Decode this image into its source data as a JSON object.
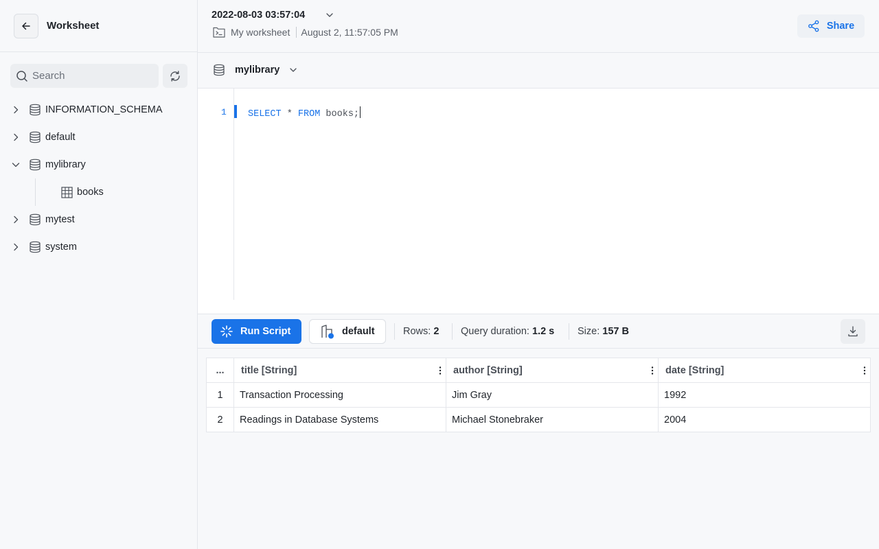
{
  "sidebar": {
    "title": "Worksheet",
    "search_placeholder": "Search",
    "databases": [
      {
        "label": "INFORMATION_SCHEMA",
        "expanded": false
      },
      {
        "label": "default",
        "expanded": false
      },
      {
        "label": "mylibrary",
        "expanded": true,
        "tables": [
          "books"
        ]
      },
      {
        "label": "mytest",
        "expanded": false
      },
      {
        "label": "system",
        "expanded": false
      }
    ]
  },
  "header": {
    "worksheet_name": "2022-08-03 03:57:04",
    "folder": "My worksheet",
    "timestamp": "August 2, 11:57:05 PM",
    "share_label": "Share"
  },
  "database_selector": {
    "selected": "mylibrary"
  },
  "editor": {
    "line_number": "1",
    "tokens": {
      "kw1": "SELECT",
      "mid": " * ",
      "kw2": "FROM",
      "rest": " books;"
    }
  },
  "toolbar": {
    "run_label": "Run Script",
    "warehouse": "default",
    "rows_label": "Rows:",
    "rows_value": "2",
    "duration_label": "Query duration:",
    "duration_value": "1.2 s",
    "size_label": "Size:",
    "size_value": "157 B"
  },
  "results": {
    "index_header": "...",
    "columns": [
      "title [String]",
      "author [String]",
      "date [String]"
    ],
    "rows": [
      {
        "index": "1",
        "cells": [
          "Transaction Processing",
          "Jim Gray",
          "1992"
        ]
      },
      {
        "index": "2",
        "cells": [
          "Readings in Database Systems",
          "Michael Stonebraker",
          "2004"
        ]
      }
    ]
  },
  "colors": {
    "accent": "#1a73e8",
    "sidebar_bg": "#f7f8fa",
    "border": "#e4e6eb"
  }
}
